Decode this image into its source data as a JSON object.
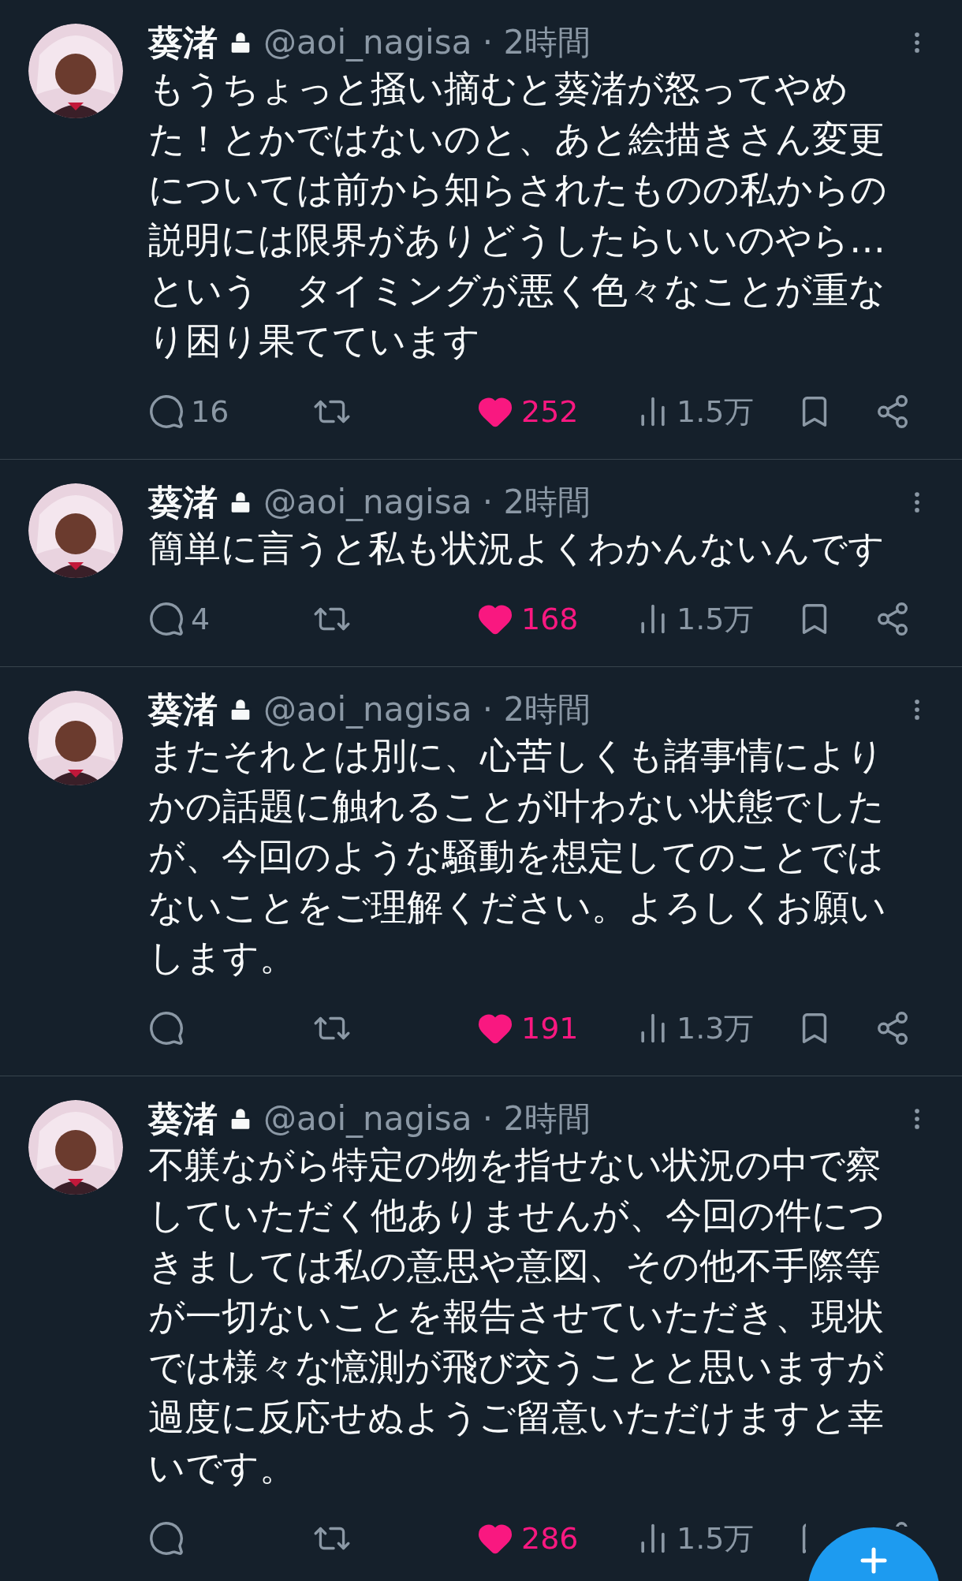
{
  "tweets": [
    {
      "name": "葵渚",
      "protected": true,
      "meta": "@aoi_nagisa · 2時間",
      "text": "もうちょっと掻い摘むと葵渚が怒ってやめた！とかではないのと、あと絵描きさん変更については前から知らされたものの私からの説明には限界がありどうしたらいいのやら…という　タイミングが悪く色々なことが重なり困り果てています",
      "replies": "16",
      "likes": "252",
      "liked": true,
      "views": "1.5万"
    },
    {
      "name": "葵渚",
      "protected": true,
      "meta": "@aoi_nagisa · 2時間",
      "text": "簡単に言うと私も状況よくわかんないんです",
      "replies": "4",
      "likes": "168",
      "liked": true,
      "views": "1.5万"
    },
    {
      "name": "葵渚",
      "protected": true,
      "meta": "@aoi_nagisa · 2時間",
      "text": "またそれとは別に、心苦しくも諸事情によりかの話題に触れることが叶わない状態でしたが、今回のような騒動を想定してのことではないことをご理解ください。よろしくお願いします。",
      "likes": "191",
      "liked": true,
      "views": "1.3万"
    },
    {
      "name": "葵渚",
      "protected": true,
      "meta": "@aoi_nagisa · 2時間",
      "text": "不躾ながら特定の物を指せない状況の中で察していただく他ありませんが、今回の件につきましては私の意思や意図、その他不手際等が一切ないことを報告させていただき、現状では様々な憶測が飛び交うことと思いますが過度に反応せぬようご留意いただけますと幸いです。",
      "likes": "286",
      "liked": true,
      "views": "1.5万"
    }
  ]
}
